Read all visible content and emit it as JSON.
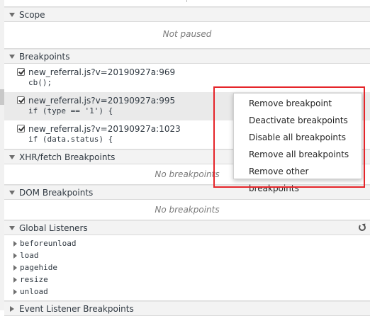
{
  "scope": {
    "title": "Scope",
    "message": "Not paused"
  },
  "breakpoints": {
    "title": "Breakpoints",
    "items": [
      {
        "location": "new_referral.js?v=20190927a:969",
        "code": "cb();",
        "checked": true,
        "selected": false
      },
      {
        "location": "new_referral.js?v=20190927a:995",
        "code": "if (type == '1') {",
        "checked": true,
        "selected": true
      },
      {
        "location": "new_referral.js?v=20190927a:1023",
        "code": "if (data.status) {",
        "checked": true,
        "selected": false
      }
    ]
  },
  "xhr": {
    "title": "XHR/fetch Breakpoints",
    "message": "No breakpoints"
  },
  "dom": {
    "title": "DOM Breakpoints",
    "message": "No breakpoints"
  },
  "global_listeners": {
    "title": "Global Listeners",
    "items": [
      "beforeunload",
      "load",
      "pagehide",
      "resize",
      "unload"
    ]
  },
  "event_listener": {
    "title": "Event Listener Breakpoints"
  },
  "context_menu": {
    "items": [
      "Remove breakpoint",
      "Deactivate breakpoints",
      "Disable all breakpoints",
      "Remove all breakpoints",
      "Remove other breakpoints"
    ]
  },
  "colors": {
    "highlight_box": "#e5252a",
    "header_bg": "#f3f3f3",
    "selected_row": "#eaeaea"
  },
  "icons": {
    "expand": "triangle-down-icon",
    "collapse": "triangle-right-icon",
    "refresh": "refresh-icon",
    "checkbox": "checkbox-checked-icon"
  }
}
